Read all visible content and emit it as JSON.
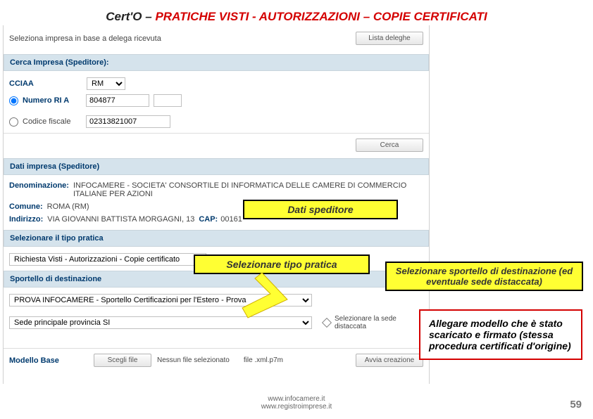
{
  "title_prefix": "Cert'O – ",
  "title_main": "PRATICHE VISTI - AUTORIZZAZIONI – COPIE CERTIFICATI",
  "top": {
    "delega_label": "Seleziona impresa in base a delega ricevuta",
    "lista_deleghe_btn": "Lista deleghe"
  },
  "cerca_impresa_header": "Cerca Impresa (Speditore):",
  "cciaa_label": "CCIAA",
  "cciaa_value": "RM",
  "numero_rea_label": "Numero RI A",
  "numero_rea_value": "804877",
  "codice_fiscale_label": "Codice fiscale",
  "codice_fiscale_value": "02313821007",
  "cerca_btn": "Cerca",
  "dati_impresa_header": "Dati impresa (Speditore)",
  "denominazione_label": "Denominazione:",
  "denominazione_value": "INFOCAMERE - SOCIETA' CONSORTILE DI INFORMATICA DELLE CAMERE DI COMMERCIO ITALIANE PER AZIONI",
  "comune_label": "Comune:",
  "comune_value": "ROMA (RM)",
  "indirizzo_label": "Indirizzo:",
  "indirizzo_value": "VIA GIOVANNI BATTISTA MORGAGNI, 13",
  "cap_label": "CAP:",
  "cap_value": "00161",
  "selezionare_tipo_header": "Selezionare il tipo pratica",
  "tipo_pratica_value": "Richiesta Visti - Autorizzazioni - Copie certificato",
  "sportello_header": "Sportello di destinazione",
  "sportello_value": "PROVA INFOCAMERE - Sportello Certificazioni per l'Estero - Prova",
  "sede_value": "Sede principale provincia SI",
  "sede_hint": "Selezionare la sede distaccata",
  "modello_base_label": "Modello Base",
  "scegli_file_btn": "Scegli file",
  "no_file_text": "Nessun file selezionato",
  "file_ext_text": "file .xml.p7m",
  "avvia_btn": "Avvia creazione",
  "callouts": {
    "dati_speditore": "Dati speditore",
    "sel_tipo": "Selezionare tipo pratica",
    "sel_sportello": "Selezionare sportello di destinazione (ed eventuale sede distaccata)",
    "allegare": "Allegare modello che è stato scaricato e firmato (stessa procedura certificati d'origine)"
  },
  "footer_line1": "www.infocamere.it",
  "footer_line2": "www.registroimprese.it",
  "page_number": "59"
}
